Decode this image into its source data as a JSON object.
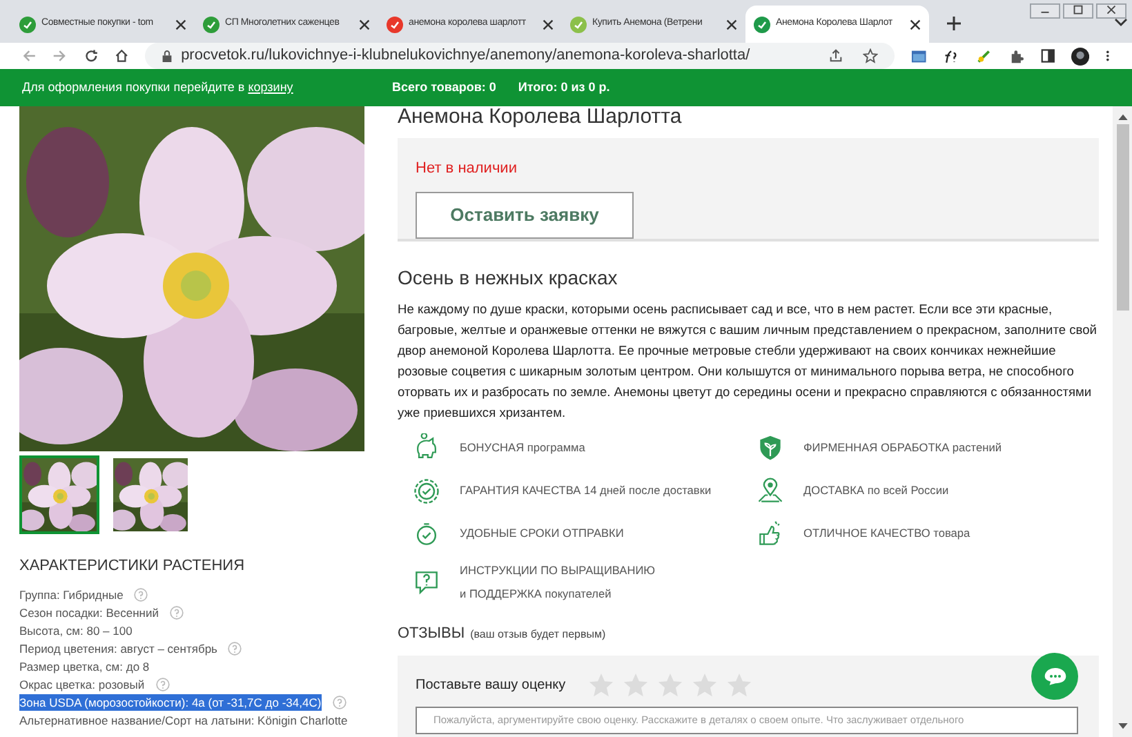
{
  "browser": {
    "tabs": [
      {
        "title": "Совместные покупки - tom",
        "selected": false,
        "color": "#2e9d3a"
      },
      {
        "title": "СП Многолетних саженцев",
        "selected": false,
        "color": "#2e9d3a"
      },
      {
        "title": "анемона королева шарлотт",
        "selected": false,
        "color": "#e8382b"
      },
      {
        "title": "Купить Анемона (Ветрени",
        "selected": false,
        "color": "#8cc04a"
      },
      {
        "title": "Анемона Королева Шарлот",
        "selected": true,
        "color": "#1f9a4a"
      }
    ],
    "url": "procvetok.ru/lukovichnye-i-klubnelukovichnye/anemony/anemona-koroleva-sharlotta/"
  },
  "banner": {
    "cart_prompt": "Для оформления покупки перейдите в",
    "cart_link": "корзину",
    "total_items": "Всего товаров: 0",
    "total": "Итого: 0 из 0 р."
  },
  "gallery": {
    "thumbnails": [
      {
        "selected": true
      },
      {
        "selected": false
      }
    ]
  },
  "characteristics": {
    "heading": "ХАРАКТЕРИСТИКИ РАСТЕНИЯ",
    "items": [
      {
        "text": "Группа: Гибридные",
        "help": true,
        "highlighted": false
      },
      {
        "text": "Сезон посадки: Весенний",
        "help": true,
        "highlighted": false
      },
      {
        "text": "Высота, см: 80 – 100",
        "help": false,
        "highlighted": false
      },
      {
        "text": "Период цветения: август – сентябрь",
        "help": true,
        "highlighted": false
      },
      {
        "text": "Размер цветка, см: до 8",
        "help": false,
        "highlighted": false
      },
      {
        "text": "Окрас цветка: розовый",
        "help": true,
        "highlighted": false
      },
      {
        "text": "Зона USDA (морозостойкости): 4а (от -31,7С до -34,4С)",
        "help": true,
        "highlighted": true
      },
      {
        "text": "Альтернативное название/Сорт на латыни: Königin Charlotte",
        "help": false,
        "highlighted": false
      }
    ]
  },
  "product": {
    "title": "Анемона Королева Шарлотта",
    "availability": "Нет в наличии",
    "request_button": "Оставить заявку"
  },
  "description": {
    "heading": "Осень в нежных красках",
    "text": "Не каждому по душе краски, которыми осень расписывает сад и все, что в нем растет. Если все эти красные, багровые, желтые и оранжевые оттенки не вяжутся с вашим личным представлением о прекрасном, заполните свой двор анемоной Королева Шарлотта. Ее прочные метровые стебли удерживают на своих кончиках нежнейшие розовые соцветия с шикарным золотым центром. Они колышутся от минимального порыва ветра, не способного оторвать их и разбросать по земле. Анемоны цветут до середины осени и прекрасно справляются с обязанностями уже приевшихся хризантем."
  },
  "features": [
    {
      "kind": "piggy",
      "lines": [
        "БОНУСНАЯ программа"
      ]
    },
    {
      "kind": "shield",
      "lines": [
        "ФИРМЕННАЯ ОБРАБОТКА растений"
      ]
    },
    {
      "kind": "badge",
      "lines": [
        "ГАРАНТИЯ КАЧЕСТВА 14 дней после доставки"
      ]
    },
    {
      "kind": "pin",
      "lines": [
        "ДОСТАВКА по всей России"
      ]
    },
    {
      "kind": "clock",
      "lines": [
        "УДОБНЫЕ СРОКИ ОТПРАВКИ"
      ]
    },
    {
      "kind": "thumb",
      "lines": [
        "ОТЛИЧНОЕ КАЧЕСТВО товара"
      ]
    },
    {
      "kind": "question",
      "lines": [
        "ИНСТРУКЦИИ ПО ВЫРАЩИВАНИЮ",
        "и ПОДДЕРЖКА покупателей"
      ]
    }
  ],
  "reviews": {
    "heading": "ОТЗЫВЫ",
    "note": "(ваш отзыв будет первым)",
    "rate_prompt": "Поставьте вашу оценку",
    "stars": 0,
    "placeholder": "Пожалуйста, аргументируйте свою оценку. Расскажите в деталях о своем опыте. Что заслуживает отдельного"
  }
}
